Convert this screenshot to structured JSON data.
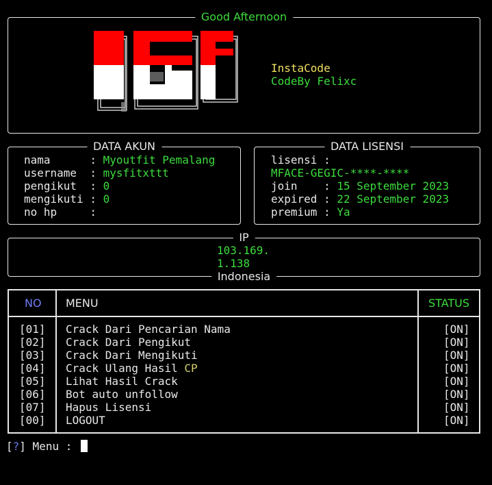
{
  "greeting": "Good Afternoon",
  "app": {
    "logo_text": "IGF",
    "name": "InstaCode",
    "credit": "CodeBy Felixc"
  },
  "akun": {
    "title": "DATA AKUN",
    "rows": [
      {
        "label": "nama      ",
        "sep": ": ",
        "value": "Myoutfit Pemalang"
      },
      {
        "label": "username  ",
        "sep": ": ",
        "value": "mysfitxttt"
      },
      {
        "label": "pengikut  ",
        "sep": ": ",
        "value": "0"
      },
      {
        "label": "mengikuti ",
        "sep": ": ",
        "value": "0"
      },
      {
        "label": "no hp     ",
        "sep": ": ",
        "value": ""
      }
    ]
  },
  "lisensi": {
    "title": "DATA LISENSI",
    "label_lisensi": "lisensi :",
    "key": "MFACE-GEGIC-****-****",
    "rows": [
      {
        "label": "join    ",
        "sep": ": ",
        "value": "15 September 2023"
      },
      {
        "label": "expired ",
        "sep": ": ",
        "value": "22 September 2023"
      },
      {
        "label": "premium ",
        "sep": ": ",
        "value": "Ya"
      }
    ]
  },
  "ip": {
    "title": "IP",
    "line1": "103.169.",
    "line2": "1.138",
    "country": "Indonesia"
  },
  "menu": {
    "headers": {
      "no": "NO",
      "menu": "MENU",
      "status": "STATUS"
    },
    "items": [
      {
        "no": "[01]",
        "label": "Crack Dari Pencarian Nama",
        "suffix": "",
        "status": "[ON]"
      },
      {
        "no": "[02]",
        "label": "Crack Dari Pengikut",
        "suffix": "",
        "status": "[ON]"
      },
      {
        "no": "[03]",
        "label": "Crack Dari Mengikuti",
        "suffix": "",
        "status": "[ON]"
      },
      {
        "no": "[04]",
        "label": "Crack Ulang Hasil ",
        "suffix": "CP",
        "status": "[ON]"
      },
      {
        "no": "[05]",
        "label": "Lihat Hasil Crack",
        "suffix": "",
        "status": "[ON]"
      },
      {
        "no": "[06]",
        "label": "Bot auto unfollow",
        "suffix": "",
        "status": "[ON]"
      },
      {
        "no": "[07]",
        "label": "Hapus Lisensi",
        "suffix": "",
        "status": "[ON]"
      },
      {
        "no": "[00]",
        "label": "LOGOUT",
        "suffix": "",
        "status": "[ON]"
      }
    ]
  },
  "prompt": {
    "open": "[",
    "q": "?",
    "close": "]",
    "text": " Menu : "
  },
  "colors": {
    "green": "#3ddc3d",
    "yellow": "#f0e060",
    "blue": "#6f7cf5",
    "logo_red": "#ff0000",
    "logo_white": "#ffffff"
  }
}
